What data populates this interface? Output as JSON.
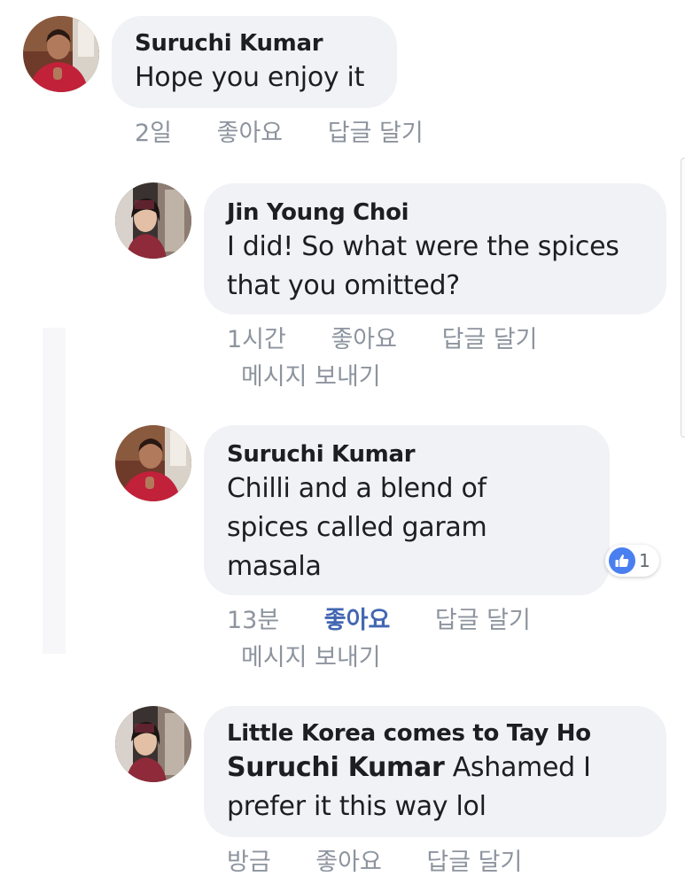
{
  "comments": [
    {
      "author": "Suruchi Kumar",
      "text": "Hope you enjoy it",
      "time": "2일",
      "like": "좋아요",
      "reply": "답글 달기"
    },
    {
      "author": "Jin Young Choi",
      "text_line1": "I did! So what were the spices",
      "text_line2": "that you omitted?",
      "time": "1시간",
      "like": "좋아요",
      "reply": "답글 달기",
      "message": "메시지 보내기"
    },
    {
      "author": "Suruchi Kumar",
      "text_line1": "Chilli and a blend of",
      "text_line2": "spices called garam",
      "text_line3": "masala",
      "reaction_count": "1",
      "time": "13분",
      "like": "좋아요",
      "reply": "답글 달기",
      "message": "메시지 보내기"
    },
    {
      "author": "Little Korea comes to Tay Ho",
      "mention": "Suruchi Kumar",
      "text_line1": " Ashamed I",
      "text_line2": "prefer it this way lol",
      "time": "방금",
      "like": "좋아요",
      "reply": "답글 달기"
    }
  ],
  "colors": {
    "bubble": "#f1f2f6",
    "meta": "#8d949e",
    "liked": "#4267b2",
    "like_badge": "#4a7ff0"
  }
}
